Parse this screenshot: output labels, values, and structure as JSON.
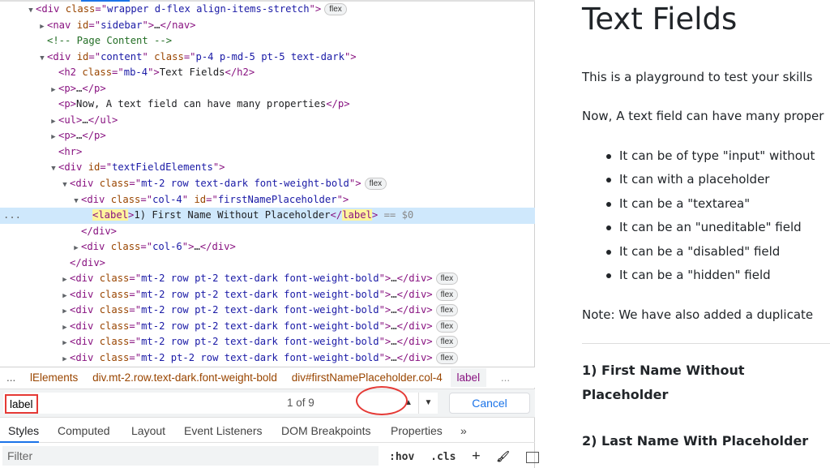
{
  "devtools": {
    "tree": [
      {
        "indent": 2,
        "tw": "▼",
        "parts": [
          [
            "tg",
            "<div "
          ],
          [
            "at",
            "class"
          ],
          [
            "tg",
            "=\""
          ],
          [
            "av",
            "wrapper d-flex align-items-stretch"
          ],
          [
            "tg",
            "\">"
          ]
        ],
        "badge": "flex"
      },
      {
        "indent": 3,
        "tw": "▶",
        "parts": [
          [
            "tg",
            "<nav "
          ],
          [
            "at",
            "id"
          ],
          [
            "tg",
            "=\""
          ],
          [
            "av",
            "sidebar"
          ],
          [
            "tg",
            "\">"
          ],
          [
            "",
            "…"
          ],
          [
            "tg",
            "</nav>"
          ]
        ]
      },
      {
        "indent": 3,
        "tw": "",
        "parts": [
          [
            "cm",
            "<!-- Page Content  -->"
          ]
        ]
      },
      {
        "indent": 3,
        "tw": "▼",
        "parts": [
          [
            "tg",
            "<div "
          ],
          [
            "at",
            "id"
          ],
          [
            "tg",
            "=\""
          ],
          [
            "av",
            "content"
          ],
          [
            "tg",
            "\" "
          ],
          [
            "at",
            "class"
          ],
          [
            "tg",
            "=\""
          ],
          [
            "av",
            "p-4 p-md-5 pt-5 text-dark"
          ],
          [
            "tg",
            "\">"
          ]
        ]
      },
      {
        "indent": 4,
        "tw": "",
        "parts": [
          [
            "tg",
            "<h2 "
          ],
          [
            "at",
            "class"
          ],
          [
            "tg",
            "=\""
          ],
          [
            "av",
            "mb-4"
          ],
          [
            "tg",
            "\">"
          ],
          [
            "",
            "Text Fields"
          ],
          [
            "tg",
            "</h2>"
          ]
        ]
      },
      {
        "indent": 4,
        "tw": "▶",
        "parts": [
          [
            "tg",
            "<p>"
          ],
          [
            "",
            "…"
          ],
          [
            "tg",
            "</p>"
          ]
        ]
      },
      {
        "indent": 4,
        "tw": "",
        "parts": [
          [
            "tg",
            "<p>"
          ],
          [
            "",
            "Now, A text field can have many properties"
          ],
          [
            "tg",
            "</p>"
          ]
        ]
      },
      {
        "indent": 4,
        "tw": "▶",
        "parts": [
          [
            "tg",
            "<ul>"
          ],
          [
            "",
            "…"
          ],
          [
            "tg",
            "</ul>"
          ]
        ]
      },
      {
        "indent": 4,
        "tw": "▶",
        "parts": [
          [
            "tg",
            "<p>"
          ],
          [
            "",
            "…"
          ],
          [
            "tg",
            "</p>"
          ]
        ]
      },
      {
        "indent": 4,
        "tw": "",
        "parts": [
          [
            "tg",
            "<hr>"
          ]
        ]
      },
      {
        "indent": 4,
        "tw": "▼",
        "parts": [
          [
            "tg",
            "<div "
          ],
          [
            "at",
            "id"
          ],
          [
            "tg",
            "=\""
          ],
          [
            "av",
            "textFieldElements"
          ],
          [
            "tg",
            "\">"
          ]
        ]
      },
      {
        "indent": 5,
        "tw": "▼",
        "parts": [
          [
            "tg",
            "<div "
          ],
          [
            "at",
            "class"
          ],
          [
            "tg",
            "=\""
          ],
          [
            "av",
            "mt-2 row text-dark font-weight-bold"
          ],
          [
            "tg",
            "\">"
          ]
        ],
        "badge": "flex"
      },
      {
        "indent": 6,
        "tw": "▼",
        "parts": [
          [
            "tg",
            "<div "
          ],
          [
            "at",
            "class"
          ],
          [
            "tg",
            "=\""
          ],
          [
            "av",
            "col-4"
          ],
          [
            "tg",
            "\" "
          ],
          [
            "at",
            "id"
          ],
          [
            "tg",
            "=\""
          ],
          [
            "av",
            "firstNamePlaceholder"
          ],
          [
            "tg",
            "\">"
          ]
        ]
      },
      {
        "indent": 7,
        "tw": "",
        "sel": true,
        "parts": [
          [
            "tg hl",
            "<label"
          ],
          [
            "tg",
            ">"
          ],
          [
            "",
            "1) First Name Without Placeholder"
          ],
          [
            "tg",
            "</"
          ],
          [
            "tg hl",
            "label"
          ],
          [
            "tg",
            ">"
          ],
          [
            "dim",
            " == $0"
          ]
        ]
      },
      {
        "indent": 6,
        "tw": "",
        "parts": [
          [
            "tg",
            "</div>"
          ]
        ]
      },
      {
        "indent": 6,
        "tw": "▶",
        "parts": [
          [
            "tg",
            "<div "
          ],
          [
            "at",
            "class"
          ],
          [
            "tg",
            "=\""
          ],
          [
            "av",
            "col-6"
          ],
          [
            "tg",
            "\">"
          ],
          [
            "",
            "…"
          ],
          [
            "tg",
            "</div>"
          ]
        ]
      },
      {
        "indent": 5,
        "tw": "",
        "parts": [
          [
            "tg",
            "</div>"
          ]
        ]
      },
      {
        "indent": 5,
        "tw": "▶",
        "parts": [
          [
            "tg",
            "<div "
          ],
          [
            "at",
            "class"
          ],
          [
            "tg",
            "=\""
          ],
          [
            "av",
            "mt-2 row pt-2 text-dark font-weight-bold"
          ],
          [
            "tg",
            "\">"
          ],
          [
            "",
            "…"
          ],
          [
            "tg",
            "</div>"
          ]
        ],
        "badge": "flex"
      },
      {
        "indent": 5,
        "tw": "▶",
        "parts": [
          [
            "tg",
            "<div "
          ],
          [
            "at",
            "class"
          ],
          [
            "tg",
            "=\""
          ],
          [
            "av",
            "mt-2 row pt-2 text-dark font-weight-bold"
          ],
          [
            "tg",
            "\">"
          ],
          [
            "",
            "…"
          ],
          [
            "tg",
            "</div>"
          ]
        ],
        "badge": "flex"
      },
      {
        "indent": 5,
        "tw": "▶",
        "parts": [
          [
            "tg",
            "<div "
          ],
          [
            "at",
            "class"
          ],
          [
            "tg",
            "=\""
          ],
          [
            "av",
            "mt-2 row pt-2 text-dark font-weight-bold"
          ],
          [
            "tg",
            "\">"
          ],
          [
            "",
            "…"
          ],
          [
            "tg",
            "</div>"
          ]
        ],
        "badge": "flex"
      },
      {
        "indent": 5,
        "tw": "▶",
        "parts": [
          [
            "tg",
            "<div "
          ],
          [
            "at",
            "class"
          ],
          [
            "tg",
            "=\""
          ],
          [
            "av",
            "mt-2 row pt-2 text-dark font-weight-bold"
          ],
          [
            "tg",
            "\">"
          ],
          [
            "",
            "…"
          ],
          [
            "tg",
            "</div>"
          ]
        ],
        "badge": "flex"
      },
      {
        "indent": 5,
        "tw": "▶",
        "parts": [
          [
            "tg",
            "<div "
          ],
          [
            "at",
            "class"
          ],
          [
            "tg",
            "=\""
          ],
          [
            "av",
            "mt-2 row pt-2 text-dark font-weight-bold"
          ],
          [
            "tg",
            "\">"
          ],
          [
            "",
            "…"
          ],
          [
            "tg",
            "</div>"
          ]
        ],
        "badge": "flex"
      },
      {
        "indent": 5,
        "tw": "▶",
        "parts": [
          [
            "tg",
            "<div "
          ],
          [
            "at",
            "class"
          ],
          [
            "tg",
            "=\""
          ],
          [
            "av",
            "mt-2 pt-2 row text-dark font-weight-bold"
          ],
          [
            "tg",
            "\">"
          ],
          [
            "",
            "…"
          ],
          [
            "tg",
            "</div>"
          ]
        ],
        "badge": "flex"
      }
    ],
    "selected_dots": "...",
    "breadcrumbs": {
      "ellipsis_left": "...",
      "items": [
        "lElements",
        "div.mt-2.row.text-dark.font-weight-bold",
        "div#firstNamePlaceholder.col-4",
        "label"
      ],
      "ellipsis_right": "..."
    },
    "search": {
      "value": "label",
      "count": "1 of 9",
      "up": "▲",
      "down": "▼",
      "cancel": "Cancel"
    },
    "tabs": [
      "Styles",
      "Computed",
      "Layout",
      "Event Listeners",
      "DOM Breakpoints",
      "Properties",
      "»"
    ],
    "filter": {
      "placeholder": "Filter",
      "hov": ":hov",
      "cls": ".cls",
      "plus": "+"
    }
  },
  "page": {
    "title": "Text Fields",
    "intro": "This is a playground to test your skills",
    "props": "Now, A text field can have many proper",
    "list": [
      "It can be of type \"input\" without",
      "It can with a placeholder",
      "It can be a \"textarea\"",
      "It can be an \"uneditable\" field",
      "It can be a \"disabled\" field",
      "It can be a \"hidden\" field"
    ],
    "note": "Note: We have also added a duplicate",
    "field1_line1": "1) First Name Without",
    "field1_line2": "Placeholder",
    "field2": "2) Last Name With Placeholder"
  }
}
